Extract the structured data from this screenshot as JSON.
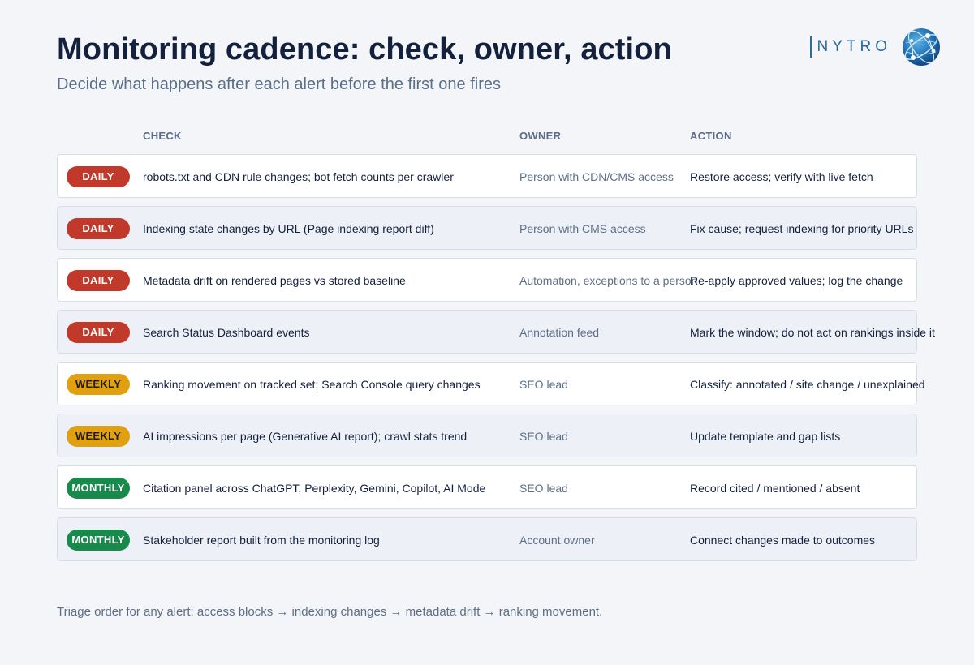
{
  "header": {
    "title": "Monitoring cadence: check, owner, action",
    "subtitle": "Decide what happens after each alert before the first one fires"
  },
  "brand": {
    "wordmark": "NYTRO",
    "logo_icon": "globe-network-icon"
  },
  "table": {
    "columns": {
      "check": "CHECK",
      "owner": "OWNER",
      "action": "ACTION"
    },
    "rows": [
      {
        "cadence": "DAILY",
        "check": "robots.txt and CDN rule changes; bot fetch counts per crawler",
        "owner": "Person with CDN/CMS access",
        "action": "Restore access; verify with live fetch"
      },
      {
        "cadence": "DAILY",
        "check": "Indexing state changes by URL (Page indexing report diff)",
        "owner": "Person with CMS access",
        "action": "Fix cause; request indexing for priority URLs"
      },
      {
        "cadence": "DAILY",
        "check": "Metadata drift on rendered pages vs stored baseline",
        "owner": "Automation, exceptions to a person",
        "action": "Re-apply approved values; log the change"
      },
      {
        "cadence": "DAILY",
        "check": "Search Status Dashboard events",
        "owner": "Annotation feed",
        "action": "Mark the window; do not act on rankings inside it"
      },
      {
        "cadence": "WEEKLY",
        "check": "Ranking movement on tracked set; Search Console query changes",
        "owner": "SEO lead",
        "action": "Classify: annotated / site change / unexplained"
      },
      {
        "cadence": "WEEKLY",
        "check": "AI impressions per page (Generative AI report); crawl stats trend",
        "owner": "SEO lead",
        "action": "Update template and gap lists"
      },
      {
        "cadence": "MONTHLY",
        "check": "Citation panel across ChatGPT, Perplexity, Gemini, Copilot, AI Mode",
        "owner": "SEO lead",
        "action": "Record cited / mentioned / absent"
      },
      {
        "cadence": "MONTHLY",
        "check": "Stakeholder report built from the monitoring log",
        "owner": "Account owner",
        "action": "Connect changes made to outcomes"
      }
    ]
  },
  "footnote": "Triage order for any alert: access blocks → indexing changes → metadata drift → ranking movement.",
  "colors": {
    "daily": "#c0392b",
    "weekly": "#e0a010",
    "monthly": "#178a4c",
    "title": "#13213d",
    "muted": "#5d7088"
  }
}
